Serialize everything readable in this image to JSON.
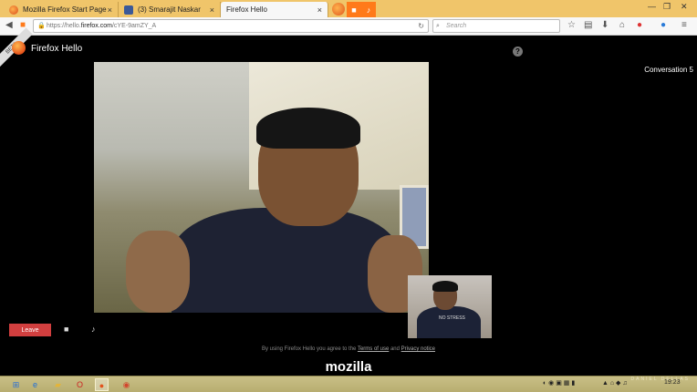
{
  "browser": {
    "tabs": [
      {
        "label": "Mozilla Firefox Start Page",
        "icon": "firefox-icon"
      },
      {
        "label": "(3) Smarajit Naskar",
        "icon": "facebook-icon"
      },
      {
        "label": "Firefox Hello",
        "icon": "none",
        "active": true
      }
    ],
    "url_prefix": "https://hello.",
    "url_domain": "firefox.com",
    "url_path": "/cYE-9amZY_A",
    "search_placeholder": "Search",
    "accent": "#ff7a1a"
  },
  "page": {
    "beta_label": "BETA",
    "app_title": "Firefox Hello",
    "help_label": "?",
    "conversation_label": "Conversation 5",
    "leave_label": "Leave",
    "legal_prefix": "By using Firefox Hello you agree to the",
    "terms_link": "Terms of use",
    "legal_and": "and",
    "privacy_link": "Privacy notice",
    "brand": "mozilla",
    "local_shirt_text": "NO STRESS",
    "leave_color": "#d13f3f"
  },
  "taskbar": {
    "clock": "19:23",
    "watermark": "DANIEL DELLAS"
  }
}
